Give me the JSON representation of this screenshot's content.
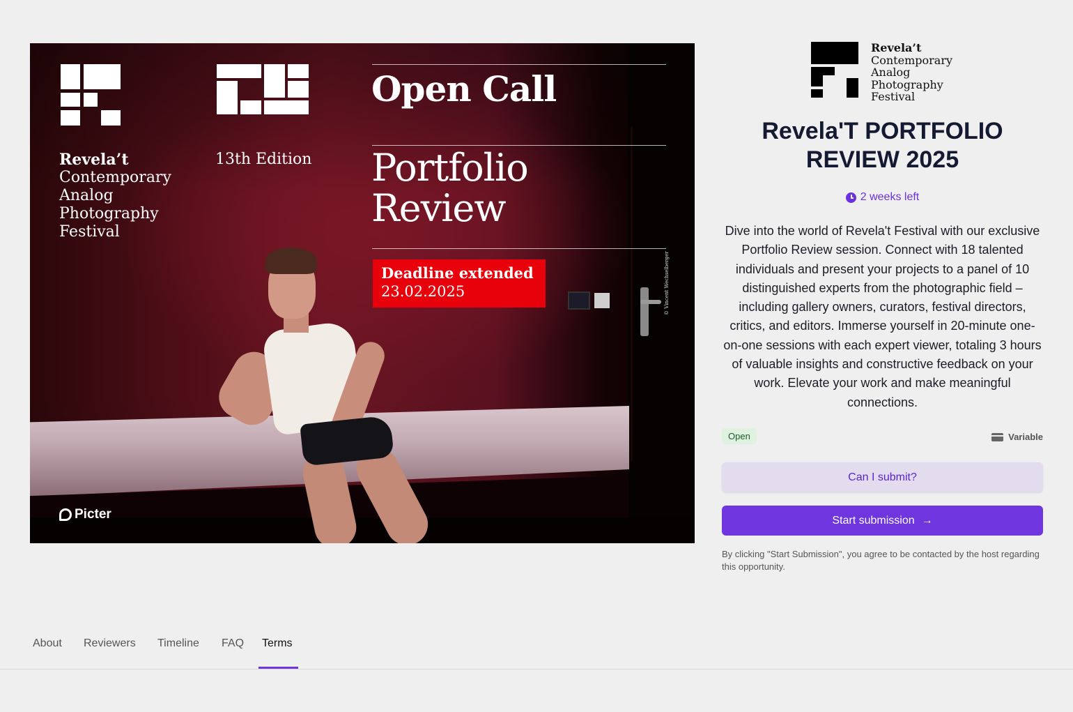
{
  "poster": {
    "festival_name_bold": "Revela’t",
    "festival_name_lines": [
      "Contemporary",
      "Analog",
      "Photography",
      "Festival"
    ],
    "edition": "13th Edition",
    "open_call": "Open Call",
    "portfolio_line1": "Portfolio",
    "portfolio_line2": "Review",
    "deadline_title": "Deadline extended",
    "deadline_date": "23.02.2025",
    "photo_credit": "© Vincent Wechselberger",
    "picter_logo": "Picter"
  },
  "brand": {
    "name_bold": "Revela’t",
    "name_lines": [
      "Contemporary",
      "Analog",
      "Photography",
      "Festival"
    ]
  },
  "title": "Revela'T PORTFOLIO REVIEW 2025",
  "time_left": "2 weeks left",
  "description": "Dive into the world of Revela't Festival with our exclusive Portfolio Review session. Connect with 18 talented individuals and present your projects to a panel of 10 distinguished experts from the photographic field – including gallery owners, curators, festival directors, critics, and editors. Immerse yourself in 20-minute one-on-one sessions with each expert viewer, totaling 3 hours of valuable insights and constructive feedback on your work. Elevate your work and make meaningful connections.",
  "status_badge": "Open",
  "fee_label": "Variable",
  "buttons": {
    "can_submit": "Can I submit?",
    "start_submission": "Start submission",
    "start_arrow": "→"
  },
  "disclaimer": "By clicking \"Start Submission\", you agree to be contacted by the host regarding this opportunity.",
  "tabs": [
    "About",
    "Reviewers",
    "Timeline",
    "FAQ",
    "Terms"
  ],
  "active_tab": "Terms",
  "colors": {
    "accent": "#6f35df",
    "deadline_red": "#e8000b",
    "open_badge_bg": "#dff2df"
  },
  "icons": [
    "clock-icon",
    "card-icon",
    "arrow-right-icon",
    "picter-logo-icon",
    "revelat-logo-mark"
  ]
}
